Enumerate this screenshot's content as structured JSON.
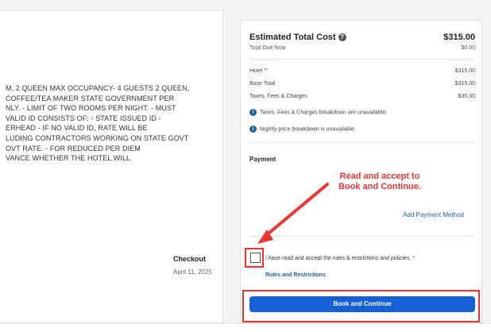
{
  "rate_description": {
    "lines": [
      "M, 2 QUEEN MAX OCCUPANCY- 4 GUESTS 2 QUEEN,",
      " COFFEE/TEA MAKER STATE GOVERNMENT PER",
      "NLY. - LIMIT OF TWO ROOMS PER NIGHT. - MUST",
      "VALID ID CONSISTS OF: - STATE ISSUED ID -",
      "ERHEAD - IF NO VALID ID, RATE WILL BE",
      "LUDING CONTRACTORS WORKING ON STATE GOVT",
      "OVT RATE. - FOR REDUCED PER DIEM",
      "VANCE WHETHER THE HOTEL WILL"
    ]
  },
  "checkout": {
    "label": "Checkout",
    "date": "April 11, 2025"
  },
  "cost": {
    "title": "Estimated Total Cost",
    "total": "$315.00",
    "due_label": "Total Due Now",
    "due_amount": "$0.00",
    "hotel_label": "Hotel",
    "hotel_amount": "$315.00",
    "base_label": "Base Total",
    "base_amount": "$315.00",
    "taxes_label": "Taxes, Fees & Charges",
    "taxes_amount": "$35.00",
    "info1": "Taxes, Fees & Charges breakdown are unavailable.",
    "info2": "Nightly price breakdown is unavailable."
  },
  "payment": {
    "label": "Payment",
    "add_method": "Add Payment Method",
    "agree_text": "I have read and accept the rules & restrictions and policies.",
    "required_mark": "*",
    "rules_link": "Rules and Restrictions",
    "book_button": "Book and Continue"
  },
  "annotation": {
    "line1": "Read and accept to",
    "line2": "Book and Continue."
  },
  "colors": {
    "accent": "#1560d6",
    "annotation": "#e33333",
    "link": "#1f5fa8"
  },
  "icons": {
    "help": "question-circle-icon",
    "info": "info-circle-icon",
    "chevron": "chevron-up-icon"
  }
}
